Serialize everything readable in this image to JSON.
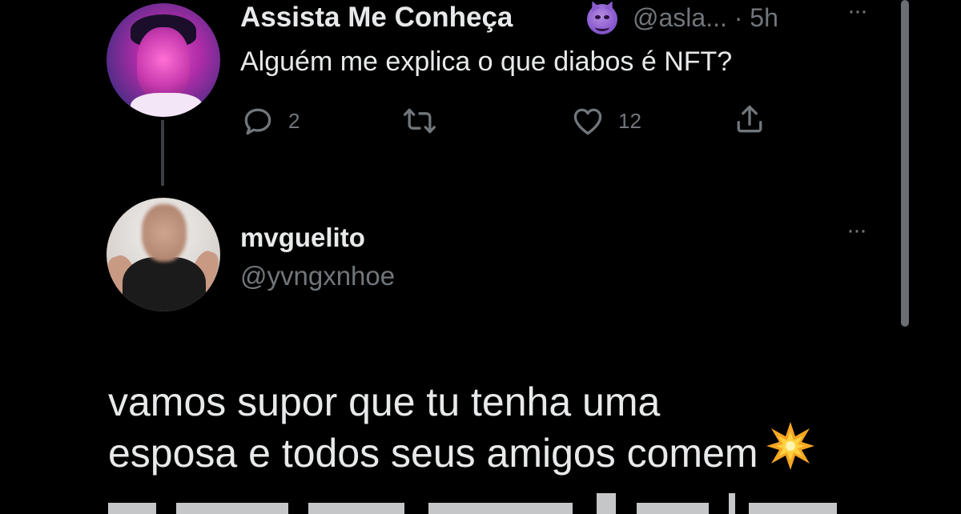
{
  "tweet1": {
    "display_name": "Assista Me Conheça",
    "handle": "@asla... · 5h",
    "text": "Alguém me explica o que diabos é NFT?",
    "reply_count": "2",
    "like_count": "12"
  },
  "tweet2": {
    "display_name": "mvguelito",
    "handle": "@yvngxnhoe",
    "body_lines": [
      "vamos supor que tu tenha uma",
      "esposa e todos seus amigos comem"
    ]
  },
  "menu_glyph": "···",
  "icons": {
    "reply": "reply-icon",
    "retweet": "retweet-icon",
    "like": "heart-icon",
    "share": "share-icon",
    "badge": "smiling-devil-emoji-icon",
    "collision": "collision-emoji-icon"
  },
  "colors": {
    "background": "#000000",
    "text": "#e7e9ea",
    "secondary_text": "#71767b",
    "devil_emoji": "#8a5ccf",
    "collision_emoji": "#f5a623"
  }
}
